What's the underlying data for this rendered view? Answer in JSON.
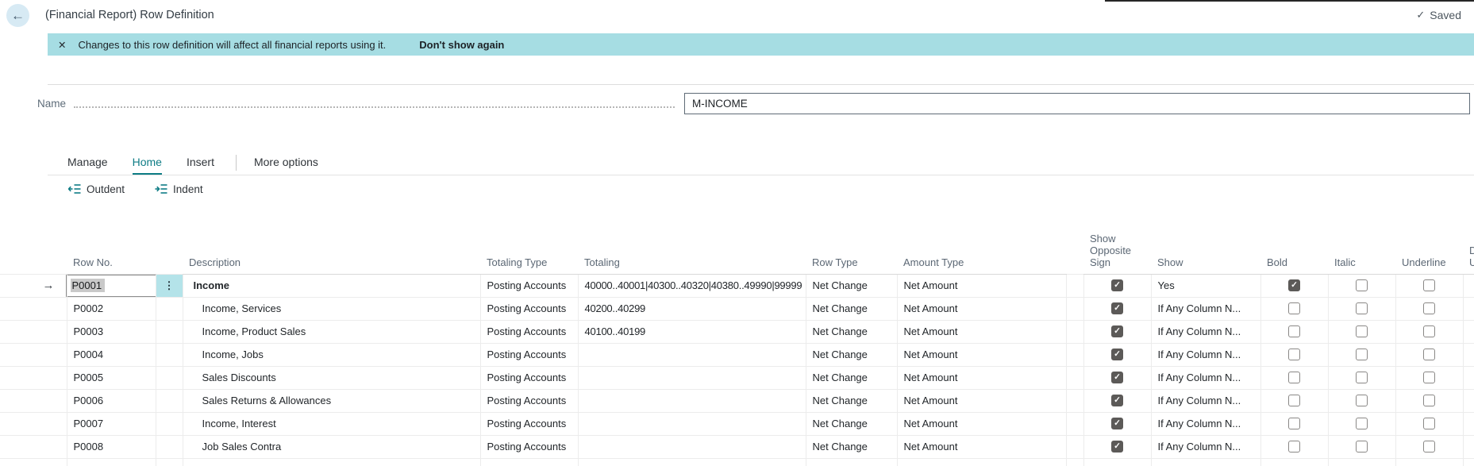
{
  "header": {
    "title": "(Financial Report) Row Definition",
    "back_icon": "left-arrow",
    "saved_check": "✓",
    "saved_label": "Saved"
  },
  "notification": {
    "close_icon": "✕",
    "message": "Changes to this row definition will affect all financial reports using it.",
    "dismiss_action": "Don't show again"
  },
  "name_field": {
    "label": "Name",
    "value": "M-INCOME"
  },
  "ribbon": {
    "tabs": [
      {
        "label": "Manage",
        "active": false
      },
      {
        "label": "Home",
        "active": true
      },
      {
        "label": "Insert",
        "active": false
      }
    ],
    "more_options_label": "More options",
    "actions": [
      {
        "label": "Outdent",
        "icon": "outdent-icon"
      },
      {
        "label": "Indent",
        "icon": "indent-icon"
      }
    ]
  },
  "grid": {
    "columns": [
      "Row No.",
      "Description",
      "Totaling Type",
      "Totaling",
      "Row Type",
      "Amount Type",
      "Show Opposite Sign",
      "Show",
      "Bold",
      "Italic",
      "Underline",
      "Double Underline"
    ],
    "current_row_icon": "→",
    "row_menu_icon": "⋮",
    "check_glyph": "✓",
    "rows": [
      {
        "selected": true,
        "row_no": "P0001",
        "description": "Income",
        "bold_description": true,
        "indent": 0,
        "totaling_type": "Posting Accounts",
        "totaling": "40000..40001|40300..40320|40380..49990|99999",
        "row_type": "Net Change",
        "amount_type": "Net Amount",
        "show_opposite_sign": true,
        "show": "Yes",
        "bold": true,
        "italic": false,
        "underline": false
      },
      {
        "selected": false,
        "row_no": "P0002",
        "description": "Income, Services",
        "bold_description": false,
        "indent": 1,
        "totaling_type": "Posting Accounts",
        "totaling": "40200..40299",
        "row_type": "Net Change",
        "amount_type": "Net Amount",
        "show_opposite_sign": true,
        "show": "If Any Column N...",
        "bold": false,
        "italic": false,
        "underline": false
      },
      {
        "selected": false,
        "row_no": "P0003",
        "description": "Income, Product Sales",
        "bold_description": false,
        "indent": 1,
        "totaling_type": "Posting Accounts",
        "totaling": "40100..40199",
        "row_type": "Net Change",
        "amount_type": "Net Amount",
        "show_opposite_sign": true,
        "show": "If Any Column N...",
        "bold": false,
        "italic": false,
        "underline": false
      },
      {
        "selected": false,
        "row_no": "P0004",
        "description": "Income, Jobs",
        "bold_description": false,
        "indent": 1,
        "totaling_type": "Posting Accounts",
        "totaling": "",
        "row_type": "Net Change",
        "amount_type": "Net Amount",
        "show_opposite_sign": true,
        "show": "If Any Column N...",
        "bold": false,
        "italic": false,
        "underline": false
      },
      {
        "selected": false,
        "row_no": "P0005",
        "description": "Sales Discounts",
        "bold_description": false,
        "indent": 1,
        "totaling_type": "Posting Accounts",
        "totaling": "",
        "row_type": "Net Change",
        "amount_type": "Net Amount",
        "show_opposite_sign": true,
        "show": "If Any Column N...",
        "bold": false,
        "italic": false,
        "underline": false
      },
      {
        "selected": false,
        "row_no": "P0006",
        "description": "Sales Returns & Allowances",
        "bold_description": false,
        "indent": 1,
        "totaling_type": "Posting Accounts",
        "totaling": "",
        "row_type": "Net Change",
        "amount_type": "Net Amount",
        "show_opposite_sign": true,
        "show": "If Any Column N...",
        "bold": false,
        "italic": false,
        "underline": false
      },
      {
        "selected": false,
        "row_no": "P0007",
        "description": "Income, Interest",
        "bold_description": false,
        "indent": 1,
        "totaling_type": "Posting Accounts",
        "totaling": "",
        "row_type": "Net Change",
        "amount_type": "Net Amount",
        "show_opposite_sign": true,
        "show": "If Any Column N...",
        "bold": false,
        "italic": false,
        "underline": false
      },
      {
        "selected": false,
        "row_no": "P0008",
        "description": "Job Sales Contra",
        "bold_description": false,
        "indent": 1,
        "totaling_type": "Posting Accounts",
        "totaling": "",
        "row_type": "Net Change",
        "amount_type": "Net Amount",
        "show_opposite_sign": true,
        "show": "If Any Column N...",
        "bold": false,
        "italic": false,
        "underline": false
      }
    ]
  },
  "colors": {
    "accent_teal": "#0e7c85",
    "notification_bg": "#a6dde3",
    "row_menu_cell_bg": "#b4e3e9",
    "checkbox_checked": "#5c5a58",
    "selection_highlight": "#c9c9c9",
    "back_button_bg": "#d7eaf4"
  }
}
